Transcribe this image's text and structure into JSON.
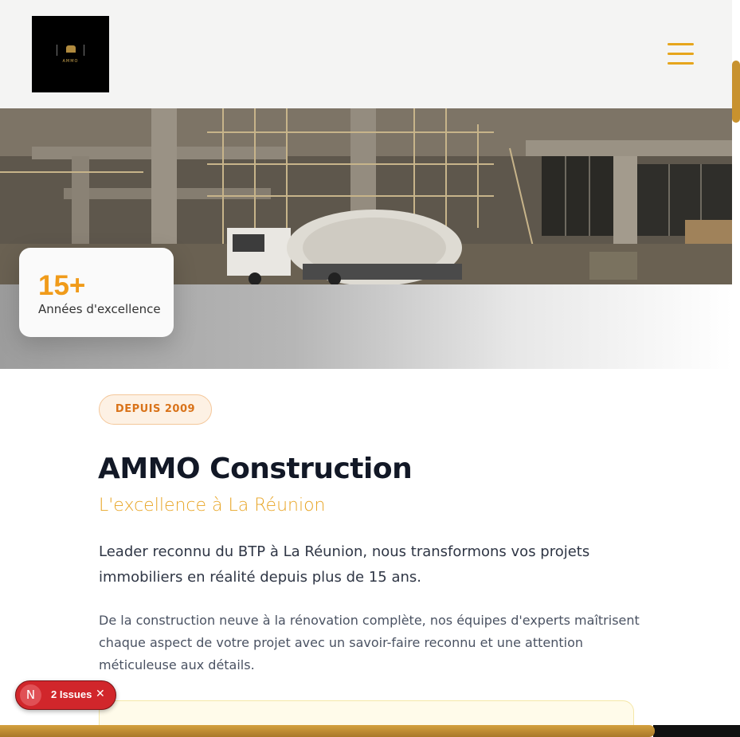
{
  "header": {
    "logo_text": "AMMO",
    "menu_icon": "hamburger-icon"
  },
  "hero": {
    "stat_value": "15+",
    "stat_label": "Années d'excellence"
  },
  "about": {
    "badge": "DEPUIS 2009",
    "title": "AMMO Construction",
    "subtitle": "L'excellence à La Réunion",
    "lead": "Leader reconnu du BTP à La Réunion, nous transformons vos projets immobiliers en réalité depuis plus de 15 ans.",
    "body": "De la construction neuve à la rénovation complète, nos équipes d'experts maîtrisent chaque aspect de votre projet avec un savoir-faire reconnu et une attention méticuleuse aux détails."
  },
  "issues_widget": {
    "initial": "N",
    "label": "2 Issues",
    "close": "✕"
  },
  "colors": {
    "accent": "#e6a51c",
    "stat": "#f09b1a",
    "badge_text": "#d9731a",
    "title": "#121826",
    "issues_bg": "#d1262b"
  }
}
